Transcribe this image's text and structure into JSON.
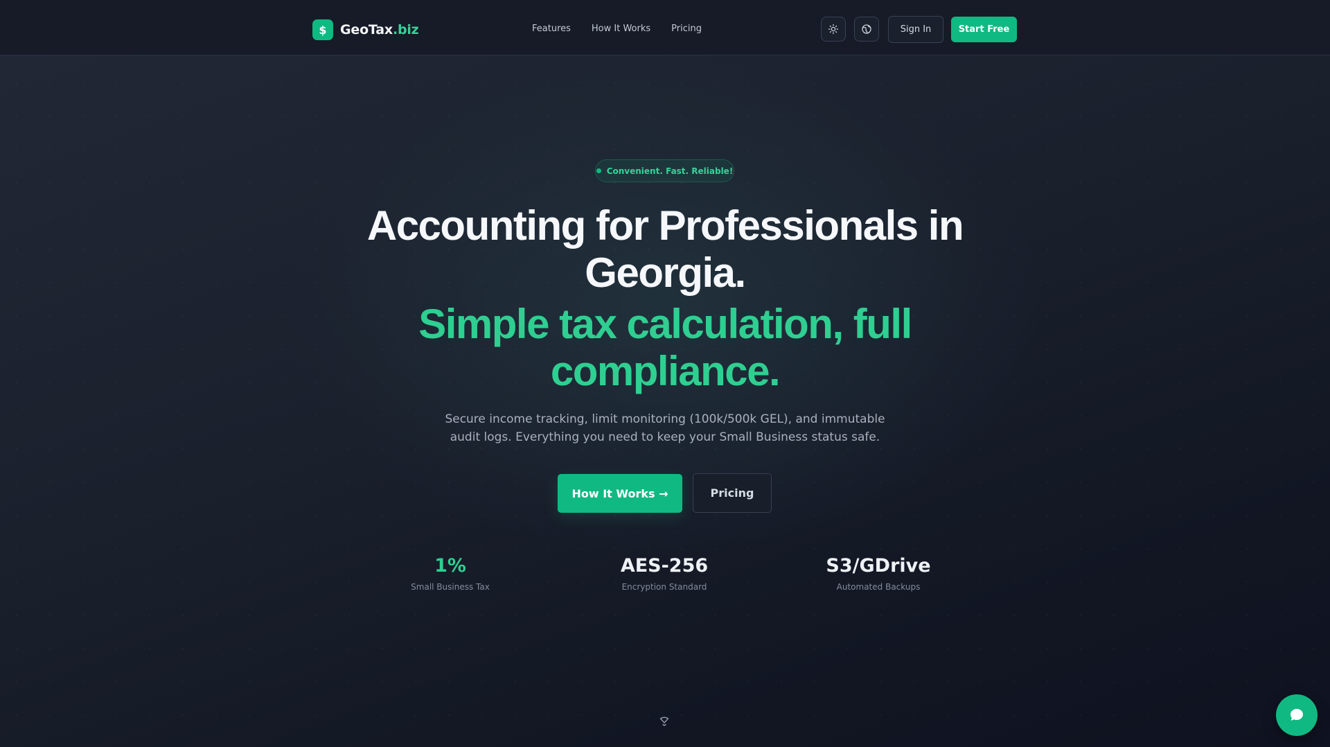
{
  "header": {
    "logo_symbol": "$",
    "logo_name": "GeoTax",
    "logo_tld": ".biz",
    "nav": [
      {
        "label": "Features"
      },
      {
        "label": "How It Works"
      },
      {
        "label": "Pricing"
      }
    ],
    "theme_icon": "sun-icon",
    "language_icon": "globe-icon",
    "sign_in_label": "Sign In",
    "start_label": "Start Free"
  },
  "hero": {
    "badge": "Convenient. Fast. Reliable!",
    "headline": "Accounting for Professionals in Georgia.",
    "subheadline": "Simple tax calculation, full compliance.",
    "description": "Secure income tracking, limit monitoring (100k/500k GEL), and immutable audit logs. Everything you need to keep your Small Business status safe.",
    "cta_primary": "How It Works →",
    "cta_secondary": "Pricing"
  },
  "stats": [
    {
      "value": "1%",
      "label": "Small Business Tax"
    },
    {
      "value": "AES-256",
      "label": "Encryption Standard"
    },
    {
      "value": "S3/GDrive",
      "label": "Automated Backups"
    }
  ],
  "scroll_icon": "chevron-down-icon",
  "chat_icon": "chat-bubble-icon",
  "colors": {
    "accent": "#10b981",
    "accent_text": "#2fcf91",
    "background": "#1a202c"
  }
}
